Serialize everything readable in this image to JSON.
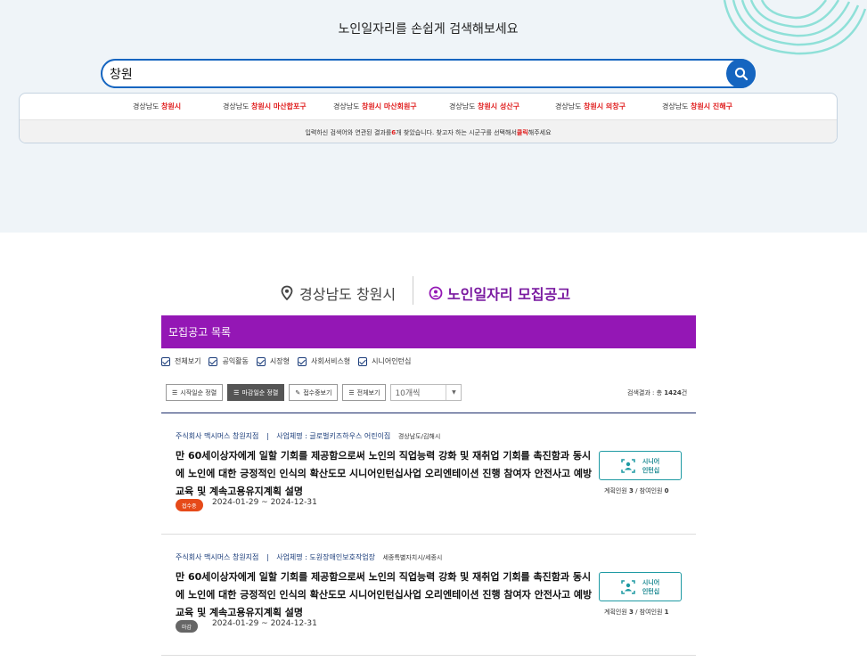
{
  "hero": {
    "title": "노인일자리를 손쉽게 검색해보세요",
    "search_value": "창원",
    "suggestions": [
      {
        "prefix": "경상남도",
        "highlight": "창원시"
      },
      {
        "prefix": "경상남도",
        "highlight": "창원시 마산합포구"
      },
      {
        "prefix": "경상남도",
        "highlight": "창원시 마산회원구"
      },
      {
        "prefix": "경상남도",
        "highlight": "창원시 성산구"
      },
      {
        "prefix": "경상남도",
        "highlight": "창원시 의창구"
      },
      {
        "prefix": "경상남도",
        "highlight": "창원시 진해구"
      }
    ],
    "note_before": "입력하신 검색어와 연관된 결과를 ",
    "note_count": "6",
    "note_mid": "개 찾았습니다. 찾고자 하는 시군구를 선택해서 ",
    "note_click": "클릭",
    "note_after": "해주세요"
  },
  "heading": {
    "location": "경상남도 창원시",
    "title": "노인일자리 모집공고"
  },
  "list": {
    "bar_title": "모집공고 목록",
    "filters": [
      "전체보기",
      "공익활동",
      "시장형",
      "사회서비스형",
      "시니어인턴십"
    ],
    "sort_buttons": [
      {
        "label": "시작일순 정렬",
        "icon": "list-icon",
        "active": false
      },
      {
        "label": "마감일순 정렬",
        "icon": "list-icon",
        "active": true
      },
      {
        "label": "접수중보기",
        "icon": "pencil-icon",
        "active": false
      },
      {
        "label": "전체보기",
        "icon": "list-icon",
        "active": false
      }
    ],
    "page_size": "10개씩",
    "count_label": "검색결과 : 총 ",
    "count_value": "1424",
    "count_unit": "건"
  },
  "jobs": [
    {
      "org": "주식회사 맥시머스 창원지점",
      "sep": "|",
      "type_label": "사업체명 : 글로벌키즈하우스 어린이집",
      "region": "경상남도/김해시",
      "desc": "만 60세이상자에게 일할 기회를 제공함으로써 노인의 직업능력 강화 및 재취업 기회를 촉진함과 동시에 노인에 대한 긍정적인 인식의 확산도모 시니어인턴십사업 오리엔테이션 진행 참여자 안전사고 예방교육 및 계속고용유지계획 설명",
      "status": "접수중",
      "dates": "2024-01-29 ~ 2024-12-31",
      "program_line1": "시니어",
      "program_line2": "인턴십",
      "planned_label": "계획인원 ",
      "planned": "3",
      "joined_label": " / 참여인원 ",
      "joined": "0"
    },
    {
      "org": "주식회사 맥시머스 창원지점",
      "sep": "|",
      "type_label": "사업체명 : 도원장애인보호작업장",
      "region": "세종특별자치시/세종시",
      "desc": "만 60세이상자에게 일할 기회를 제공함으로써 노인의 직업능력 강화 및 재취업 기회를 촉진함과 동시에 노인에 대한 긍정적인 인식의 확산도모 시니어인턴십사업 오리엔테이션 진행 참여자 안전사고 예방교육 및 계속고용유지계획 설명",
      "status": "마감",
      "dates": "2024-01-29 ~ 2024-12-31",
      "program_line1": "시니어",
      "program_line2": "인턴십",
      "planned_label": "계획인원 ",
      "planned": "3",
      "joined_label": " / 참여인원 ",
      "joined": "1"
    }
  ],
  "colors": {
    "accent_blue": "#1565c0",
    "purple": "#9417b5",
    "highlight_red": "#e01e1e",
    "teal": "#1e9aa3",
    "open_badge": "#e64a19",
    "closed_badge": "#666666"
  }
}
